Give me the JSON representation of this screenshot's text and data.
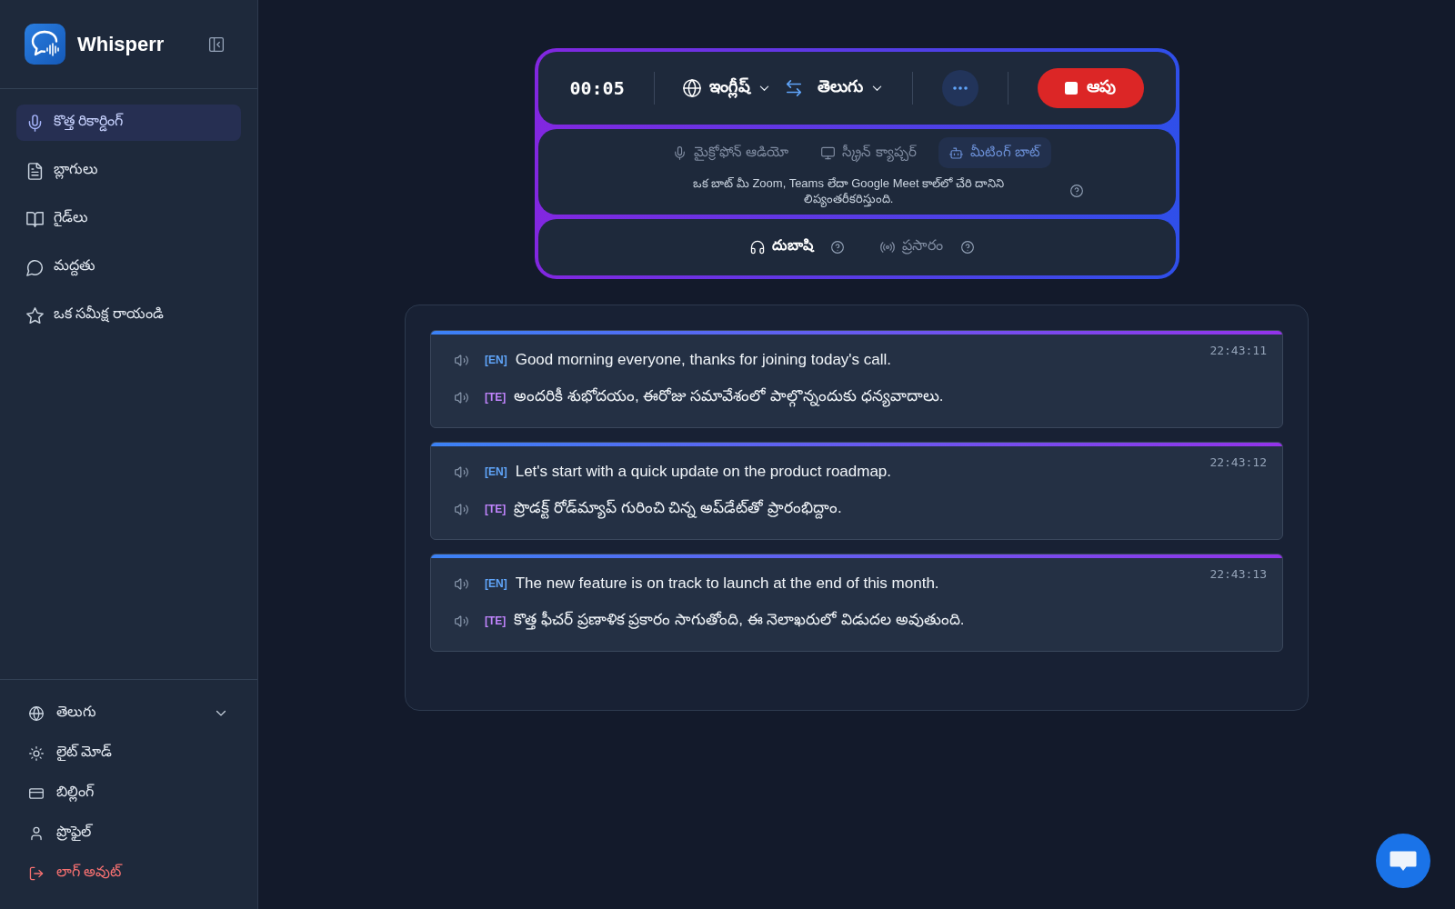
{
  "sidebar": {
    "app_name": "Whisperr",
    "nav_items": [
      {
        "label": "కొత్త రికార్డింగ్",
        "selected": true
      },
      {
        "label": "బ్లాగులు",
        "selected": false
      },
      {
        "label": "గైడ్‌లు",
        "selected": false
      },
      {
        "label": "మద్దతు",
        "selected": false
      },
      {
        "label": "ఒక సమీక్ష రాయండి",
        "selected": false
      }
    ],
    "footer_items": [
      {
        "label": "తెలుగు",
        "kind": "select"
      },
      {
        "label": "లైట్ మోడ్",
        "kind": "link"
      },
      {
        "label": "బిల్లింగ్",
        "kind": "link"
      },
      {
        "label": "ప్రొఫైల్",
        "kind": "link"
      },
      {
        "label": "లాగ్ అవుట్",
        "kind": "danger"
      }
    ]
  },
  "recorder": {
    "timer": "00:05",
    "source_language": "ఇంగ్లీష్",
    "target_language": "తెలుగు",
    "stop_button": "ఆపు",
    "capture_modes": [
      {
        "label": "మైక్రోఫోన్ ఆడియో",
        "selected": false
      },
      {
        "label": "స్క్రీన్ క్యాప్చర్",
        "selected": false
      },
      {
        "label": "మీటింగ్ బాట్",
        "selected": true
      }
    ],
    "mode_description": "ఒక బాట్ మీ Zoom, Teams లేదా Google Meet కాల్‌లో చేరి దానిని లిప్యంతరీకరిస్తుంది.",
    "output_modes": [
      {
        "label": "దుబాషి",
        "selected": true
      },
      {
        "label": "ప్రసారం",
        "selected": false
      }
    ]
  },
  "transcript": {
    "entries": [
      {
        "time": "22:43:11",
        "lines": [
          {
            "tag": "[EN]",
            "color": "#60a5fa",
            "text": "Good morning everyone, thanks for joining today's call."
          },
          {
            "tag": "[TE]",
            "color": "#c084fc",
            "text": "అందరికీ శుభోదయం, ఈరోజు సమావేశంలో పాల్గొన్నందుకు ధన్యవాదాలు."
          }
        ]
      },
      {
        "time": "22:43:12",
        "lines": [
          {
            "tag": "[EN]",
            "color": "#60a5fa",
            "text": "Let's start with a quick update on the product roadmap."
          },
          {
            "tag": "[TE]",
            "color": "#c084fc",
            "text": "ప్రొడక్ట్ రోడ్‌మ్యాప్ గురించి చిన్న అప్‌డేట్‌తో ప్రారంభిద్దాం."
          }
        ]
      },
      {
        "time": "22:43:13",
        "lines": [
          {
            "tag": "[EN]",
            "color": "#60a5fa",
            "text": "The new feature is on track to launch at the end of this month."
          },
          {
            "tag": "[TE]",
            "color": "#c084fc",
            "text": "కొత్త ఫీచర్ ప్రణాళిక ప్రకారం సాగుతోంది, ఈ నెలాఖరులో విడుదల అవుతుంది."
          }
        ]
      }
    ]
  }
}
